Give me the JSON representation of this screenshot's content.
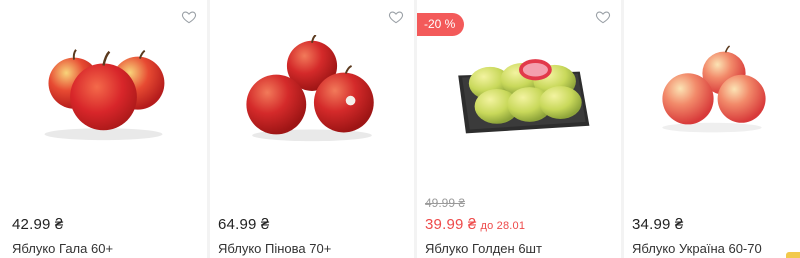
{
  "products": [
    {
      "name": "Яблуко Гала 60+",
      "price": "42.99 ₴",
      "old_price": "",
      "until": "",
      "badge": "",
      "image": "apples-gala"
    },
    {
      "name": "Яблуко Пінова 70+",
      "price": "64.99 ₴",
      "old_price": "",
      "until": "",
      "badge": "",
      "image": "apples-pinova"
    },
    {
      "name": "Яблуко Голден 6шт",
      "price": "39.99 ₴",
      "old_price": "49.99 ₴",
      "until": "до 28.01",
      "badge": "-20 %",
      "image": "apples-golden-tray"
    },
    {
      "name": "Яблуко Україна 60-70",
      "price": "34.99 ₴",
      "old_price": "",
      "until": "",
      "badge": "",
      "image": "apples-ukraina"
    }
  ],
  "icons": {
    "favorite": "heart-outline-icon"
  },
  "colors": {
    "sale": "#ee4a4a",
    "badge_bg": "#f35a5a",
    "scroll_thumb": "#f2c94c"
  }
}
